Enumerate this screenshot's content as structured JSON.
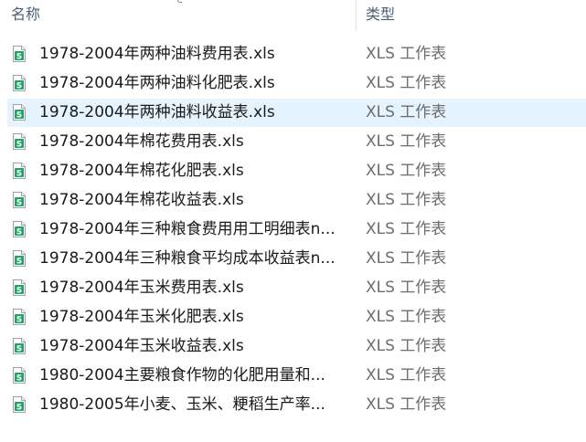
{
  "header": {
    "name_label": "名称",
    "type_label": "类型"
  },
  "colors": {
    "selected_row": "#e5f3ff",
    "excel_green": "#21a366",
    "header_text": "#4c607a",
    "type_text": "#6d6d6d"
  },
  "files": [
    {
      "name": "1978-2004年两种油料费用表.xls",
      "type": "XLS 工作表",
      "icon": "excel-file-icon",
      "selected": false
    },
    {
      "name": "1978-2004年两种油料化肥表.xls",
      "type": "XLS 工作表",
      "icon": "excel-file-icon",
      "selected": false
    },
    {
      "name": "1978-2004年两种油料收益表.xls",
      "type": "XLS 工作表",
      "icon": "excel-file-icon",
      "selected": true
    },
    {
      "name": "1978-2004年棉花费用表.xls",
      "type": "XLS 工作表",
      "icon": "excel-file-icon",
      "selected": false
    },
    {
      "name": "1978-2004年棉花化肥表.xls",
      "type": "XLS 工作表",
      "icon": "excel-file-icon",
      "selected": false
    },
    {
      "name": "1978-2004年棉花收益表.xls",
      "type": "XLS 工作表",
      "icon": "excel-file-icon",
      "selected": false
    },
    {
      "name": "1978-2004年三种粮食费用用工明细表n...",
      "type": "XLS 工作表",
      "icon": "excel-file-icon",
      "selected": false
    },
    {
      "name": "1978-2004年三种粮食平均成本收益表n...",
      "type": "XLS 工作表",
      "icon": "excel-file-icon",
      "selected": false
    },
    {
      "name": "1978-2004年玉米费用表.xls",
      "type": "XLS 工作表",
      "icon": "excel-file-icon",
      "selected": false
    },
    {
      "name": "1978-2004年玉米化肥表.xls",
      "type": "XLS 工作表",
      "icon": "excel-file-icon",
      "selected": false
    },
    {
      "name": "1978-2004年玉米收益表.xls",
      "type": "XLS 工作表",
      "icon": "excel-file-icon",
      "selected": false
    },
    {
      "name": "1980-2004主要粮食作物的化肥用量和...",
      "type": "XLS 工作表",
      "icon": "excel-file-icon",
      "selected": false
    },
    {
      "name": "1980-2005年小麦、玉米、粳稻生产率...",
      "type": "XLS 工作表",
      "icon": "excel-file-icon",
      "selected": false
    }
  ]
}
